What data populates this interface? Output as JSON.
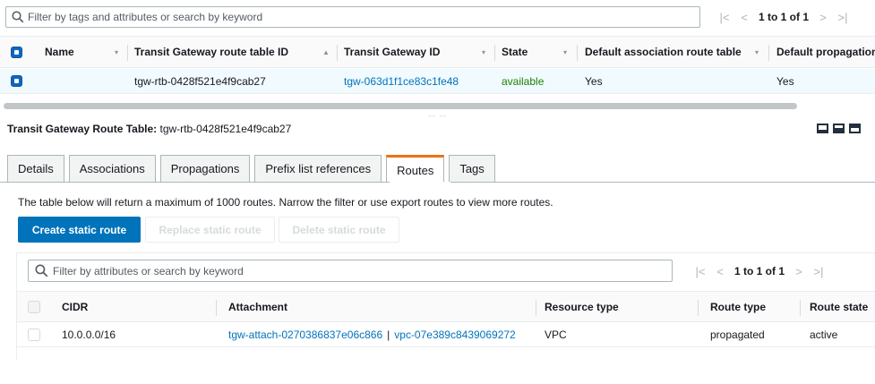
{
  "top": {
    "search_placeholder": "Filter by tags and attributes or search by keyword",
    "pagination": {
      "first": "|<",
      "prev": "<",
      "label": "1 to 1 of 1",
      "next": ">",
      "last": ">|"
    },
    "columns": [
      {
        "label": "Name",
        "sort": "▾"
      },
      {
        "label": "Transit Gateway route table ID",
        "sort": "▲"
      },
      {
        "label": "Transit Gateway ID",
        "sort": "▾"
      },
      {
        "label": "State",
        "sort": "▾"
      },
      {
        "label": "Default association route table",
        "sort": "▾"
      },
      {
        "label": "Default propagation route table",
        "sort": ""
      }
    ],
    "row": {
      "name": "",
      "route_table_id": "tgw-rtb-0428f521e4f9cab27",
      "tgw_id": "tgw-063d1f1ce83c1fe48",
      "state": "available",
      "default_association": "Yes",
      "default_propagation": "Yes"
    }
  },
  "details": {
    "title_label": "Transit Gateway Route Table:",
    "title_value": "tgw-rtb-0428f521e4f9cab27",
    "tabs": [
      "Details",
      "Associations",
      "Propagations",
      "Prefix list references",
      "Routes",
      "Tags"
    ],
    "active_tab": "Routes",
    "info_text": "The table below will return a maximum of 1000 routes. Narrow the filter or use export routes to view more routes.",
    "buttons": {
      "create": "Create static route",
      "replace": "Replace static route",
      "delete": "Delete static route"
    }
  },
  "routes": {
    "search_placeholder": "Filter by attributes or search by keyword",
    "pagination": {
      "first": "|<",
      "prev": "<",
      "label": "1 to 1 of 1",
      "next": ">",
      "last": ">|"
    },
    "columns": [
      "CIDR",
      "Attachment",
      "Resource type",
      "Route type",
      "Route state"
    ],
    "rows": [
      {
        "cidr": "10.0.0.0/16",
        "attachment_id": "tgw-attach-0270386837e06c866",
        "separator": "|",
        "resource_id": "vpc-07e389c8439069272",
        "resource_type": "VPC",
        "route_type": "propagated",
        "route_state": "active"
      }
    ]
  },
  "colors": {
    "link": "#0073bb",
    "available": "#1d8102",
    "primary_button": "#0073bb",
    "active_tab_accent": "#ec7211",
    "selected_row": "#f1faff"
  }
}
